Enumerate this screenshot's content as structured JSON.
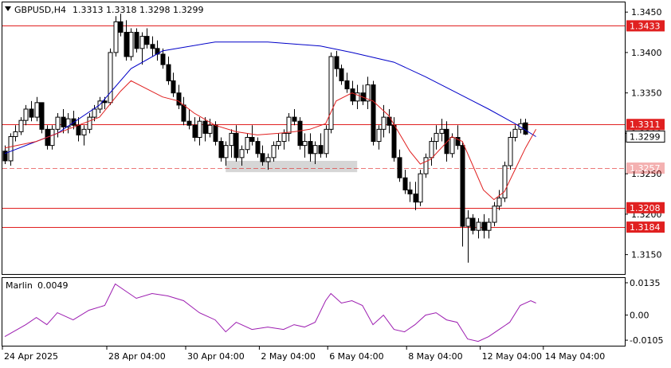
{
  "header": {
    "symbol": "GBPUSD,H4",
    "open": "1.3313",
    "high": "1.3318",
    "low": "1.3298",
    "close": "1.3299"
  },
  "indicator": {
    "name": "Marlin",
    "value": "0.0049"
  },
  "colors": {
    "background": "#ffffff",
    "frame": "#000000",
    "bull_body": "#ffffff",
    "bear_body": "#000000",
    "blue_ma": "#0000c8",
    "red_ma": "#e02020",
    "level_line": "#e02020",
    "level_label_bg": "#e02020",
    "marlin": "#9c1cb0",
    "zone": "#c8c8c8"
  },
  "chart_data": [
    {
      "type": "candlestick",
      "title": "GBPUSD,H4",
      "x_labels": [
        "24 Apr 2025",
        "28 Apr 04:00",
        "30 Apr 04:00",
        "2 May 04:00",
        "6 May 04:00",
        "8 May 04:00",
        "12 May 04:00",
        "14 May 04:00"
      ],
      "y_ticks": [
        "1.3450",
        "1.3400",
        "1.3350",
        "1.3300",
        "1.3250",
        "1.3200",
        "1.3150"
      ],
      "ylim": [
        1.3126,
        1.3462
      ],
      "price_label": "1.3299",
      "levels": [
        {
          "value": 1.3433,
          "label": "1.3433",
          "style": "solid"
        },
        {
          "value": 1.3311,
          "label": "1.3311",
          "style": "solid"
        },
        {
          "value": 1.3257,
          "label": "1.3257",
          "style": "dashed"
        },
        {
          "value": 1.3208,
          "label": "1.3208",
          "style": "solid"
        },
        {
          "value": 1.3184,
          "label": "1.3184",
          "style": "solid"
        }
      ],
      "zone": {
        "from": 1.3252,
        "to": 1.3266,
        "bar_start": 42,
        "bar_end": 67
      },
      "candles": [
        [
          1.3278,
          1.3285,
          1.3262,
          1.3266
        ],
        [
          1.3266,
          1.33,
          1.326,
          1.3296
        ],
        [
          1.3296,
          1.331,
          1.329,
          1.3302
        ],
        [
          1.3302,
          1.332,
          1.3298,
          1.3316
        ],
        [
          1.3316,
          1.3335,
          1.331,
          1.333
        ],
        [
          1.333,
          1.334,
          1.3315,
          1.332
        ],
        [
          1.332,
          1.3345,
          1.3315,
          1.3338
        ],
        [
          1.3338,
          1.333,
          1.33,
          1.3305
        ],
        [
          1.3305,
          1.331,
          1.328,
          1.3285
        ],
        [
          1.3285,
          1.331,
          1.328,
          1.3305
        ],
        [
          1.3305,
          1.3325,
          1.3295,
          1.332
        ],
        [
          1.332,
          1.333,
          1.33,
          1.3308
        ],
        [
          1.3308,
          1.3325,
          1.33,
          1.3318
        ],
        [
          1.3318,
          1.3328,
          1.3305,
          1.331
        ],
        [
          1.331,
          1.332,
          1.329,
          1.3298
        ],
        [
          1.3298,
          1.331,
          1.3285,
          1.3305
        ],
        [
          1.3305,
          1.3325,
          1.33,
          1.332
        ],
        [
          1.332,
          1.3335,
          1.3315,
          1.333
        ],
        [
          1.333,
          1.3345,
          1.3325,
          1.334
        ],
        [
          1.334,
          1.3345,
          1.333,
          1.3338
        ],
        [
          1.3338,
          1.3405,
          1.3335,
          1.34
        ],
        [
          1.34,
          1.3445,
          1.3395,
          1.3438
        ],
        [
          1.3438,
          1.3448,
          1.342,
          1.3425
        ],
        [
          1.3425,
          1.344,
          1.339,
          1.3395
        ],
        [
          1.3395,
          1.343,
          1.339,
          1.3425
        ],
        [
          1.3425,
          1.343,
          1.34,
          1.3405
        ],
        [
          1.3405,
          1.3425,
          1.3385,
          1.342
        ],
        [
          1.342,
          1.343,
          1.3405,
          1.341
        ],
        [
          1.341,
          1.342,
          1.3395,
          1.3405
        ],
        [
          1.3405,
          1.3415,
          1.339,
          1.3398
        ],
        [
          1.3398,
          1.3405,
          1.338,
          1.3385
        ],
        [
          1.3385,
          1.3395,
          1.336,
          1.3365
        ],
        [
          1.3365,
          1.3375,
          1.3345,
          1.335
        ],
        [
          1.335,
          1.336,
          1.333,
          1.3335
        ],
        [
          1.3335,
          1.3345,
          1.331,
          1.3315
        ],
        [
          1.3315,
          1.333,
          1.3305,
          1.331
        ],
        [
          1.331,
          1.332,
          1.329,
          1.3295
        ],
        [
          1.3295,
          1.332,
          1.3285,
          1.3315
        ],
        [
          1.3315,
          1.332,
          1.329,
          1.33
        ],
        [
          1.33,
          1.3318,
          1.3295,
          1.331
        ],
        [
          1.331,
          1.3315,
          1.3285,
          1.329
        ],
        [
          1.329,
          1.3295,
          1.3265,
          1.327
        ],
        [
          1.327,
          1.329,
          1.326,
          1.3285
        ],
        [
          1.3285,
          1.3305,
          1.327,
          1.33
        ],
        [
          1.33,
          1.331,
          1.3265,
          1.327
        ],
        [
          1.327,
          1.3285,
          1.326,
          1.328
        ],
        [
          1.328,
          1.33,
          1.3275,
          1.3295
        ],
        [
          1.3295,
          1.331,
          1.3285,
          1.329
        ],
        [
          1.329,
          1.3295,
          1.327,
          1.3275
        ],
        [
          1.3275,
          1.3285,
          1.326,
          1.3265
        ],
        [
          1.3265,
          1.3275,
          1.3255,
          1.327
        ],
        [
          1.327,
          1.329,
          1.3265,
          1.3285
        ],
        [
          1.3285,
          1.33,
          1.328,
          1.329
        ],
        [
          1.329,
          1.3305,
          1.328,
          1.33
        ],
        [
          1.33,
          1.3325,
          1.329,
          1.332
        ],
        [
          1.332,
          1.333,
          1.331,
          1.3315
        ],
        [
          1.3315,
          1.332,
          1.328,
          1.3285
        ],
        [
          1.3285,
          1.33,
          1.327,
          1.329
        ],
        [
          1.329,
          1.33,
          1.3265,
          1.3275
        ],
        [
          1.3275,
          1.329,
          1.3262,
          1.3285
        ],
        [
          1.3285,
          1.33,
          1.327,
          1.3275
        ],
        [
          1.3275,
          1.331,
          1.327,
          1.3305
        ],
        [
          1.3305,
          1.34,
          1.33,
          1.3395
        ],
        [
          1.3395,
          1.3402,
          1.337,
          1.338
        ],
        [
          1.338,
          1.3385,
          1.336,
          1.3365
        ],
        [
          1.3365,
          1.3375,
          1.335,
          1.3355
        ],
        [
          1.3355,
          1.3365,
          1.3335,
          1.334
        ],
        [
          1.334,
          1.336,
          1.333,
          1.335
        ],
        [
          1.335,
          1.336,
          1.3335,
          1.334
        ],
        [
          1.334,
          1.337,
          1.333,
          1.336
        ],
        [
          1.336,
          1.3365,
          1.3285,
          1.329
        ],
        [
          1.329,
          1.331,
          1.328,
          1.3305
        ],
        [
          1.3305,
          1.3335,
          1.3295,
          1.332
        ],
        [
          1.332,
          1.333,
          1.33,
          1.331
        ],
        [
          1.331,
          1.332,
          1.3265,
          1.327
        ],
        [
          1.327,
          1.328,
          1.324,
          1.3245
        ],
        [
          1.3245,
          1.3255,
          1.3225,
          1.323
        ],
        [
          1.323,
          1.324,
          1.3215,
          1.3225
        ],
        [
          1.3225,
          1.324,
          1.3205,
          1.3215
        ],
        [
          1.3215,
          1.3255,
          1.321,
          1.325
        ],
        [
          1.325,
          1.3275,
          1.3245,
          1.327
        ],
        [
          1.327,
          1.3295,
          1.326,
          1.329
        ],
        [
          1.329,
          1.331,
          1.328,
          1.33
        ],
        [
          1.33,
          1.3318,
          1.329,
          1.3305
        ],
        [
          1.3305,
          1.3315,
          1.3265,
          1.3275
        ],
        [
          1.3275,
          1.33,
          1.327,
          1.3295
        ],
        [
          1.3295,
          1.331,
          1.328,
          1.3285
        ],
        [
          1.3285,
          1.329,
          1.316,
          1.3185
        ],
        [
          1.3185,
          1.3205,
          1.314,
          1.3195
        ],
        [
          1.3195,
          1.32,
          1.3175,
          1.318
        ],
        [
          1.318,
          1.3195,
          1.317,
          1.319
        ],
        [
          1.319,
          1.32,
          1.317,
          1.318
        ],
        [
          1.318,
          1.3195,
          1.317,
          1.319
        ],
        [
          1.319,
          1.3215,
          1.3185,
          1.321
        ],
        [
          1.321,
          1.323,
          1.3205,
          1.322
        ],
        [
          1.322,
          1.3265,
          1.3215,
          1.326
        ],
        [
          1.326,
          1.3302,
          1.3255,
          1.3295
        ],
        [
          1.3295,
          1.331,
          1.329,
          1.3305
        ],
        [
          1.3305,
          1.3318,
          1.33,
          1.3312
        ],
        [
          1.3313,
          1.3318,
          1.3298,
          1.3299
        ]
      ],
      "series": [
        {
          "key": "blue_ma",
          "color": "#0000c8",
          "points": [
            [
              0,
              1.3275
            ],
            [
              10,
              1.33
            ],
            [
              18,
              1.3335
            ],
            [
              24,
              1.338
            ],
            [
              30,
              1.3402
            ],
            [
              40,
              1.3413
            ],
            [
              50,
              1.3413
            ],
            [
              60,
              1.3408
            ],
            [
              66,
              1.34
            ],
            [
              74,
              1.3388
            ],
            [
              80,
              1.337
            ],
            [
              86,
              1.335
            ],
            [
              92,
              1.333
            ],
            [
              97,
              1.3312
            ],
            [
              101,
              1.3296
            ]
          ]
        },
        {
          "key": "red_ma",
          "color": "#e02020",
          "points": [
            [
              0,
              1.3282
            ],
            [
              6,
              1.329
            ],
            [
              12,
              1.3305
            ],
            [
              18,
              1.332
            ],
            [
              22,
              1.3352
            ],
            [
              24,
              1.3365
            ],
            [
              27,
              1.3355
            ],
            [
              30,
              1.3345
            ],
            [
              33,
              1.334
            ],
            [
              36,
              1.3325
            ],
            [
              40,
              1.331
            ],
            [
              44,
              1.3302
            ],
            [
              48,
              1.3298
            ],
            [
              52,
              1.33
            ],
            [
              55,
              1.3302
            ],
            [
              58,
              1.3305
            ],
            [
              61,
              1.3312
            ],
            [
              63,
              1.334
            ],
            [
              66,
              1.335
            ],
            [
              70,
              1.334
            ],
            [
              73,
              1.3322
            ],
            [
              75,
              1.33
            ],
            [
              77,
              1.3278
            ],
            [
              79,
              1.3262
            ],
            [
              81,
              1.3268
            ],
            [
              83,
              1.3282
            ],
            [
              85,
              1.3296
            ],
            [
              87,
              1.329
            ],
            [
              89,
              1.326
            ],
            [
              91,
              1.323
            ],
            [
              93,
              1.3218
            ],
            [
              95,
              1.3228
            ],
            [
              97,
              1.3255
            ],
            [
              99,
              1.3282
            ],
            [
              101,
              1.3305
            ]
          ]
        }
      ]
    },
    {
      "type": "line",
      "title": "Marlin",
      "y_ticks": [
        "0.0135",
        "0.00",
        "-0.0105"
      ],
      "ylim": [
        -0.0128,
        0.0155
      ],
      "series": [
        {
          "name": "Marlin",
          "color": "#9c1cb0",
          "points": [
            [
              0,
              -0.009
            ],
            [
              4,
              -0.004
            ],
            [
              6,
              -0.001
            ],
            [
              8,
              -0.004
            ],
            [
              10,
              0.001
            ],
            [
              13,
              -0.002
            ],
            [
              16,
              0.002
            ],
            [
              19,
              0.004
            ],
            [
              21,
              0.013
            ],
            [
              23,
              0.01
            ],
            [
              25,
              0.007
            ],
            [
              28,
              0.009
            ],
            [
              31,
              0.008
            ],
            [
              34,
              0.006
            ],
            [
              37,
              0.001
            ],
            [
              40,
              -0.002
            ],
            [
              42,
              -0.007
            ],
            [
              44,
              -0.003
            ],
            [
              47,
              -0.006
            ],
            [
              50,
              -0.005
            ],
            [
              53,
              -0.006
            ],
            [
              55,
              -0.004
            ],
            [
              57,
              -0.005
            ],
            [
              59,
              -0.003
            ],
            [
              61,
              0.006
            ],
            [
              62,
              0.009
            ],
            [
              64,
              0.005
            ],
            [
              66,
              0.006
            ],
            [
              68,
              0.004
            ],
            [
              70,
              -0.004
            ],
            [
              72,
              0.0
            ],
            [
              74,
              -0.006
            ],
            [
              76,
              -0.007
            ],
            [
              78,
              -0.004
            ],
            [
              80,
              0.0
            ],
            [
              82,
              0.001
            ],
            [
              84,
              -0.002
            ],
            [
              86,
              -0.003
            ],
            [
              88,
              -0.01
            ],
            [
              90,
              -0.011
            ],
            [
              92,
              -0.009
            ],
            [
              94,
              -0.006
            ],
            [
              96,
              -0.003
            ],
            [
              98,
              0.004
            ],
            [
              100,
              0.006
            ],
            [
              101,
              0.005
            ]
          ]
        }
      ]
    }
  ]
}
